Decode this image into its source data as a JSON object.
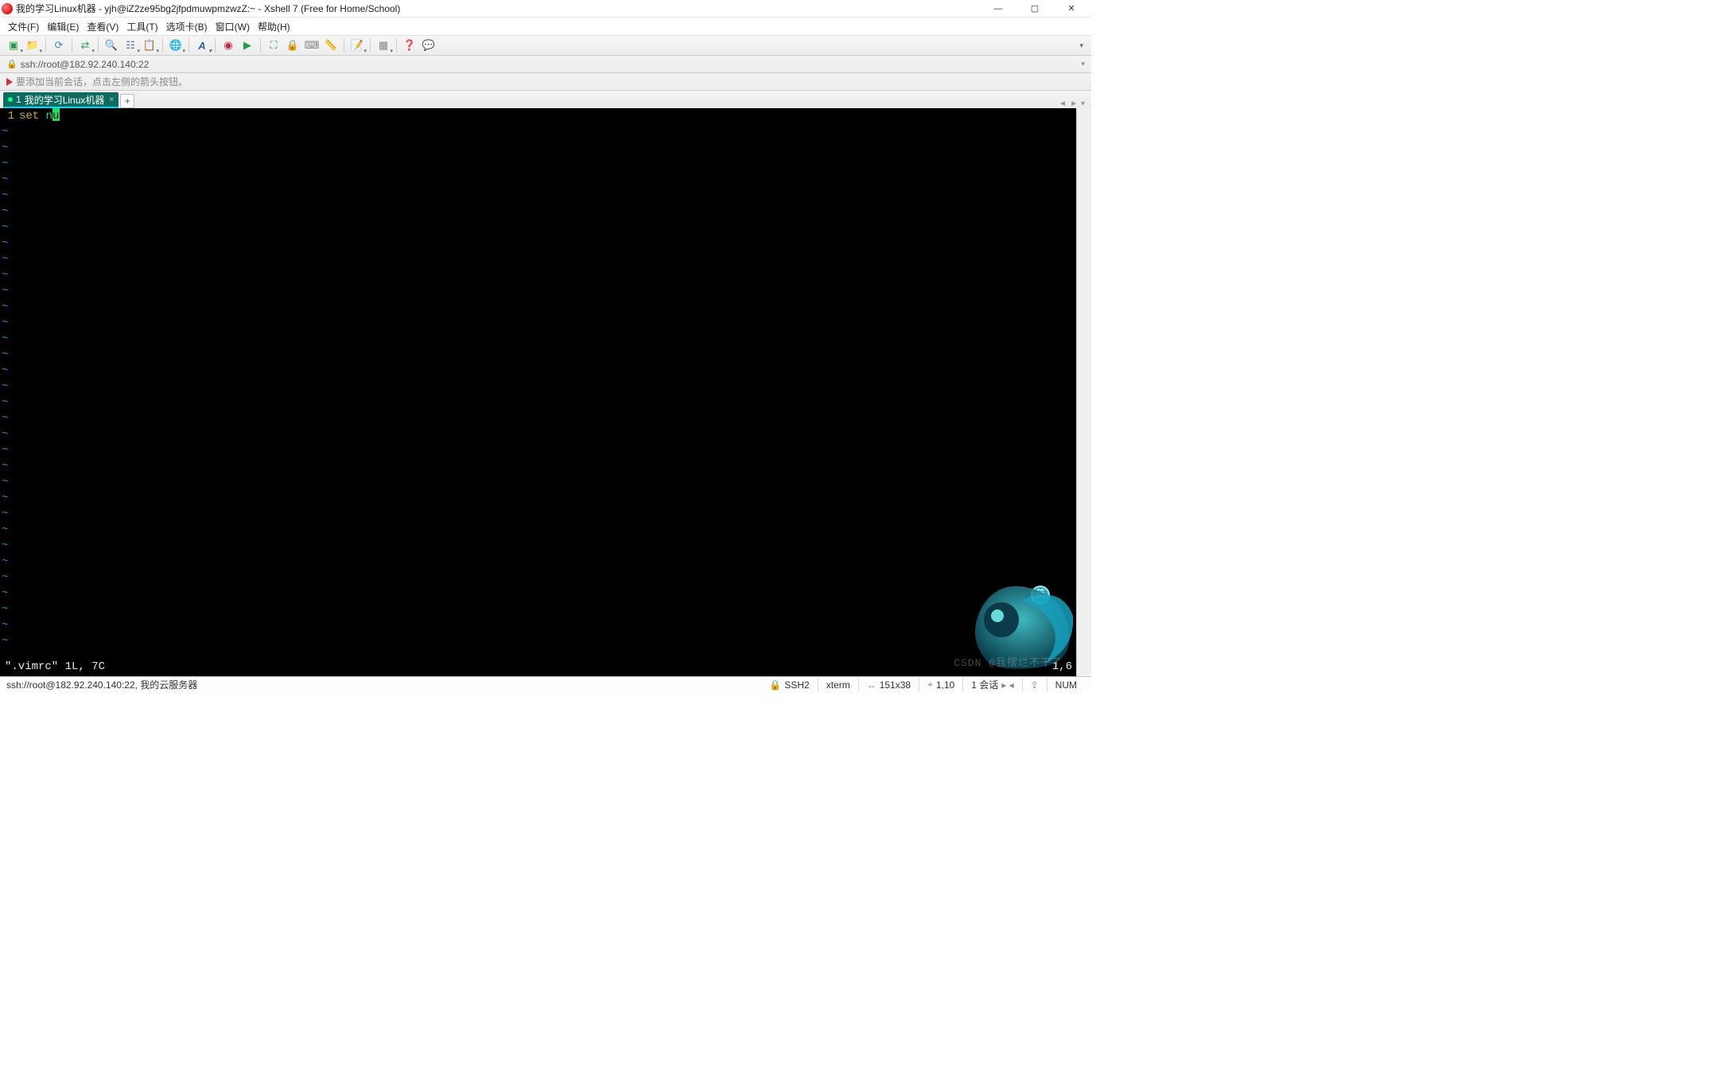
{
  "title": "我的学习Linux机器 - yjh@iZ2ze95bg2jfpdmuwpmzwzZ:~ - Xshell 7 (Free for Home/School)",
  "menu": [
    "文件(F)",
    "编辑(E)",
    "查看(V)",
    "工具(T)",
    "选项卡(B)",
    "窗口(W)",
    "帮助(H)"
  ],
  "address": "ssh://root@182.92.240.140:22",
  "hint": "要添加当前会话，点击左侧的箭头按钮。",
  "tab": {
    "index": "1",
    "label": "我的学习Linux机器"
  },
  "terminal": {
    "lineno": "1",
    "keyword": "set",
    "ident_pre": "n",
    "cursor_char": "u",
    "tilde_rows": 33,
    "vim_msg": "\".vimrc\" 1L, 7C",
    "vim_pos": "1,6"
  },
  "ime": "英",
  "watermark": "CSDN @我摆烂不干了",
  "status": {
    "left": "ssh://root@182.92.240.140:22, 我的云服务器",
    "proto": "SSH2",
    "termtype": "xterm",
    "size": "151x38",
    "cursor": "1,10",
    "sessions": "1 会话",
    "caps_icon": "⇪",
    "num": "NUM"
  }
}
